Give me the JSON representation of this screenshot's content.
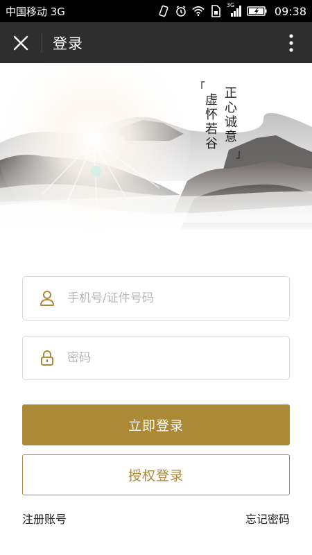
{
  "status_bar": {
    "carrier": "中国移动 3G",
    "network_type": "3G",
    "time": "09:38",
    "icons": [
      "vibrate-icon",
      "alarm-icon",
      "wifi-icon",
      "sim-icon",
      "signal-icon",
      "battery-icon"
    ]
  },
  "header": {
    "title": "登录",
    "close_icon": "close-icon",
    "more_icon": "more-vert-icon",
    "background_color": "#2e2e2e"
  },
  "hero": {
    "poem_col1": "正心诚意",
    "poem_col2": "虚怀若谷",
    "bracket_open": "「",
    "bracket_close": "」"
  },
  "form": {
    "phone_placeholder": "手机号/证件号码",
    "phone_value": "",
    "password_placeholder": "密码",
    "password_value": "",
    "login_button": "立即登录",
    "auth_button": "授权登录",
    "register_link": "注册账号",
    "forgot_link": "忘记密码"
  },
  "colors": {
    "accent": "#ab8936",
    "border": "#d9d9d9",
    "placeholder": "#b7b7b7"
  }
}
